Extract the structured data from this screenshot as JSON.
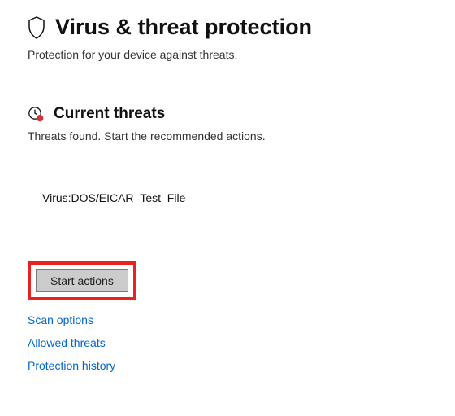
{
  "header": {
    "title": "Virus & threat protection",
    "subtitle": "Protection for your device against threats."
  },
  "section": {
    "title": "Current threats",
    "subtitle": "Threats found. Start the recommended actions."
  },
  "threats": {
    "items": [
      {
        "name": "Virus:DOS/EICAR_Test_File"
      }
    ]
  },
  "actions": {
    "start_actions_label": "Start actions"
  },
  "links": {
    "scan_options": "Scan options",
    "allowed_threats": "Allowed threats",
    "protection_history": "Protection history"
  }
}
